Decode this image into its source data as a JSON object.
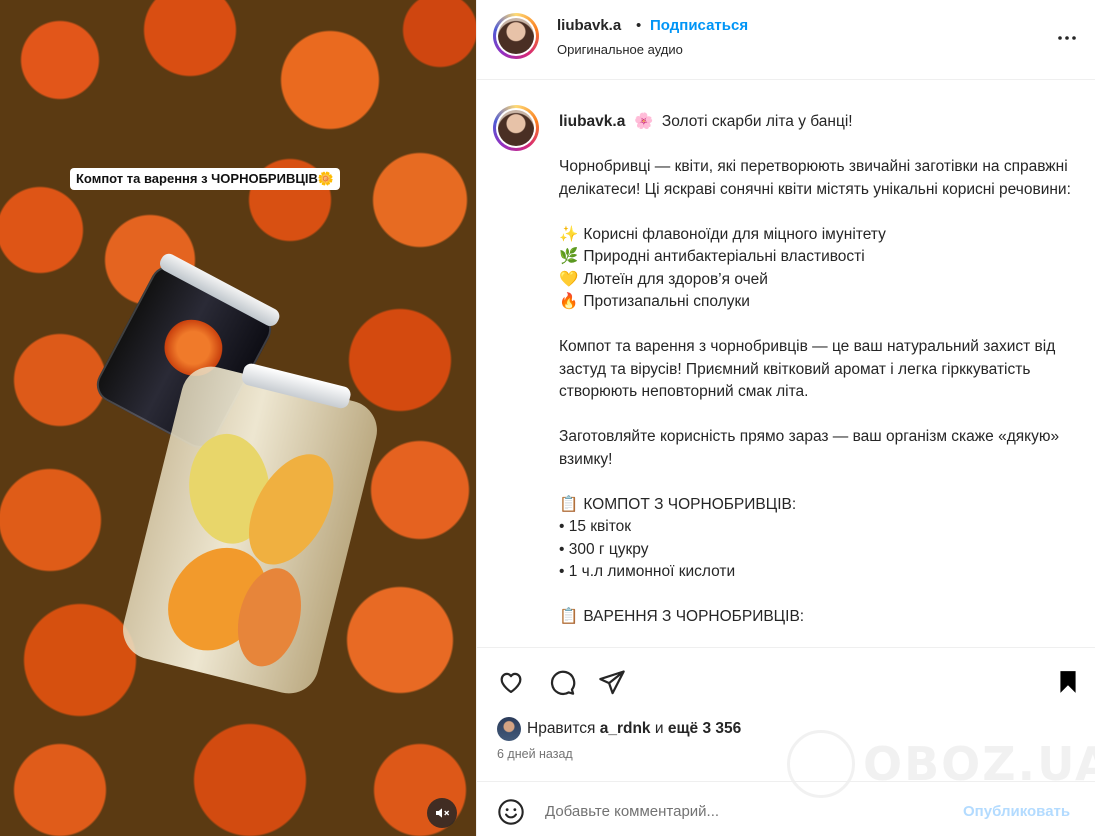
{
  "media": {
    "overlay_caption": "Компот та варення з ЧОРНОБРИВЦІВ🌼",
    "mute_icon": "speaker-muted-icon"
  },
  "header": {
    "username": "liubavk.a",
    "separator": "•",
    "follow_label": "Подписаться",
    "audio_label": "Оригинальное аудио",
    "more_icon": "more-horizontal-icon"
  },
  "caption": {
    "username": "liubavk.a",
    "title_emoji": "🌸",
    "title": "Золоті скарби літа у банці!",
    "para1": "Чорнобривці — квіти, які перетворюють звичайні заготівки на справжні делікатеси! Ці яскраві сонячні квіти містять унікальні корисні речовини:",
    "benefits": [
      {
        "emoji": "✨",
        "text": "Корисні флавоноїди для міцного імунітету"
      },
      {
        "emoji": "🌿",
        "text": "Природні антибактеріальні властивості"
      },
      {
        "emoji": "💛",
        "text": "Лютеїн для здоров’я очей"
      },
      {
        "emoji": "🔥",
        "text": "Протизапальні сполуки"
      }
    ],
    "para2": "Компот та варення з чорнобривців — це ваш натуральний захист від застуд та вірусів! Приємний квітковий аромат і легка гірккуватість створюють неповторний смак літа.",
    "para3": "Заготовляйте корисність прямо зараз — ваш організм скаже «дякую» взимку!",
    "compote": {
      "emoji": "📋",
      "heading": "КОМПОТ З ЧОРНОБРИВЦІВ:",
      "items": [
        "• 15 квіток",
        "• 300 г цукру",
        "• 1 ч.л лимонної кислоти"
      ]
    },
    "jam": {
      "emoji": "📋",
      "heading": "ВАРЕННЯ З ЧОРНОБРИВЦІВ:"
    }
  },
  "actions": {
    "likes_prefix": "Нравится",
    "liker": "a_rdnk",
    "likes_conj": "и",
    "likes_rest": "ещё 3 356",
    "time": "6 дней назад"
  },
  "comment": {
    "placeholder": "Добавьте комментарий...",
    "publish_label": "Опубликовать"
  },
  "watermark": "OBOZ.UA"
}
